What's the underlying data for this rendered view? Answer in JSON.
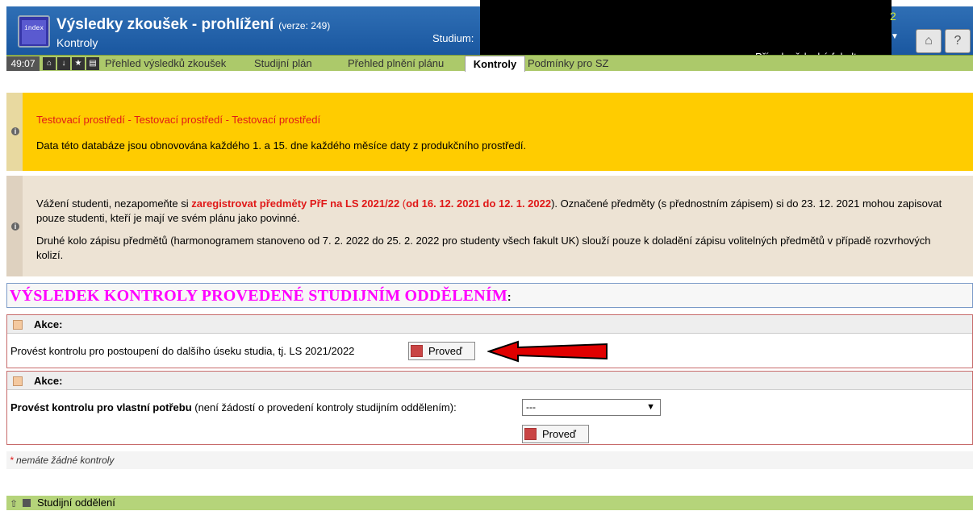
{
  "header": {
    "title": "Výsledky zkoušek - prohlížení",
    "version": "(verze: 249)",
    "subtitle": "Kontroly",
    "study_label": "Studium:",
    "corner_number": "2",
    "faculty": "Přírodovědecká fakulta"
  },
  "tabbar": {
    "timer": "49:07",
    "tabs": [
      "Přehled výsledků zkoušek",
      "Studijní plán",
      "Přehled plnění plánu",
      "Kontroly",
      "Podmínky pro SZ"
    ]
  },
  "notice_test": {
    "red_text": "Testovací prostředí - Testovací prostředí - Testovací prostředí",
    "text": "Data této databáze jsou obnovována každého 1. a 15. dne každého měsíce daty z produkčního prostředí."
  },
  "notice_reg": {
    "p1_a": "Vážení studenti, nezapomeňte si ",
    "p1_b": "zaregistrovat předměty PřF na LS 2021/22",
    "p1_c": " (",
    "p1_d": "od 16. 12. 2021 do 12. 1. 2022",
    "p1_e": "). Označené předměty (s přednostním zápisem) si do 23. 12. 2021 mohou zapisovat pouze studenti, kteří je mají ve svém plánu jako povinné.",
    "p2": "Druhé kolo zápisu předmětů (harmonogramem stanoveno od 7. 2. 2022 do 25. 2. 2022 pro studenty všech fakult UK) slouží pouze k doladění zápisu volitelných předmětů v případě rozvrhových kolizí."
  },
  "result_heading": "VÝSLEDEK KONTROLY PROVEDENÉ STUDIJNÍM ODDĚLENÍM",
  "box1": {
    "header": "Akce:",
    "text": "Provést kontrolu pro postoupení do dalšího úseku studia, tj. LS 2021/2022",
    "button": "Proveď"
  },
  "box2": {
    "header": "Akce:",
    "text_bold": "Provést kontrolu pro vlastní potřebu",
    "text_rest": " (není žádostí o provedení kontroly studijním oddělením):",
    "select_value": "---",
    "button": "Proveď"
  },
  "footer_note": {
    "star": "*",
    "text": " nemáte žádné kontroly"
  },
  "bottom_bar": "Studijní oddělení",
  "colors": {
    "header_blue": "#1a57a0",
    "tabbar_green": "#acc96a",
    "notice_yellow": "#ffcc00",
    "heading_magenta": "#ff00ff",
    "arrow_red": "#e00000"
  }
}
